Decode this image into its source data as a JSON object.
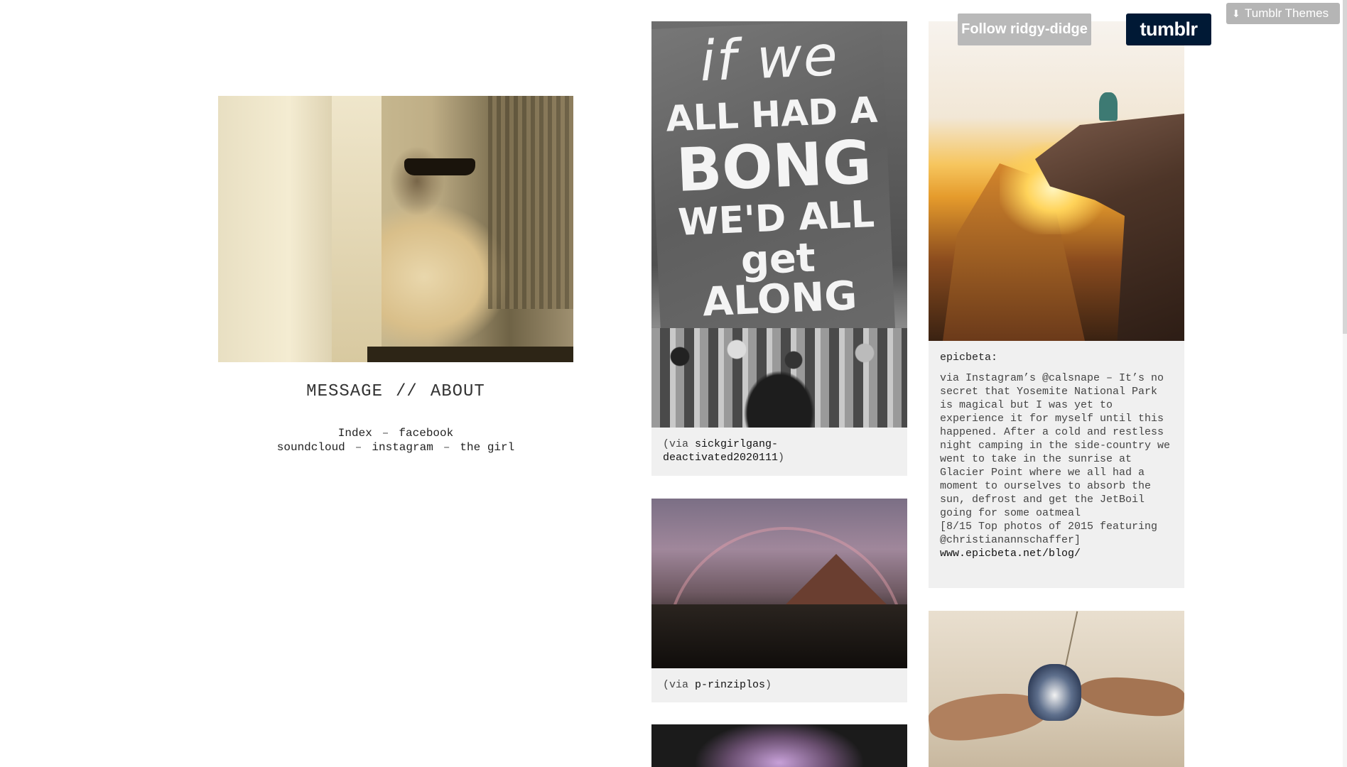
{
  "sidebar": {
    "nav": {
      "message": "MESSAGE",
      "separator": "//",
      "about": "ABOUT"
    },
    "links": {
      "index": "Index",
      "facebook": "facebook",
      "soundcloud": "soundcloud",
      "instagram": "instagram",
      "the_girl": "the girl",
      "dash": "–"
    }
  },
  "posts": [
    {
      "sign_text": [
        "if we",
        "ALL HAD A",
        "BONG",
        "WE'D ALL",
        "get ALONG"
      ],
      "via_prefix": "(via ",
      "source": "sickgirlgang-deactivated2020111",
      "via_suffix": ")"
    },
    {
      "via_prefix": "(via ",
      "source": "p-rinziplos",
      "via_suffix": ")"
    },
    {
      "author": "epicbeta:",
      "body": "via Instagram’s @calsnape – It’s no secret that Yosemite National Park is magical but I was yet to experience it for myself until this happened. After a cold and restless night camping in the side-country we went to take in the sunrise at Glacier Point where we all had a moment to ourselves to absorb the sun, defrost and get the JetBoil going for some oatmeal\n[8/15 Top photos of 2015 featuring @christianannschaffer]",
      "link": "www.epicbeta.net/blog/"
    }
  ],
  "tumblr": {
    "follow_label": "Follow ridgy-didge",
    "logo_label": "tumblr",
    "themes_label": "Tumblr Themes",
    "themes_icon": "download-icon"
  }
}
